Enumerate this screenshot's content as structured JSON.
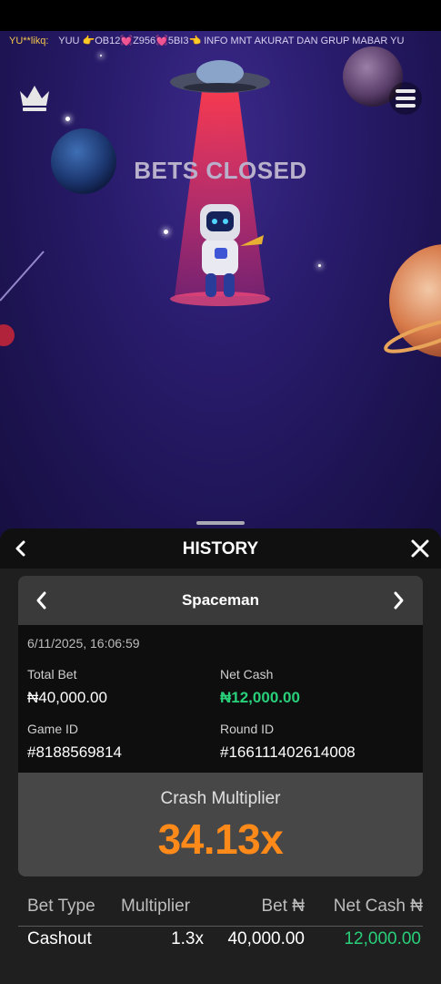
{
  "ticker": {
    "user": "YU**likq:",
    "message": "YUU 👉OB12💓Z956💓5BI3👈 INFO MNT AKURAT DAN GRUP MABAR YU"
  },
  "scene": {
    "status_text": "BETS CLOSED"
  },
  "icons": {
    "crown": "crown-icon",
    "menu": "hamburger-menu-icon",
    "back": "chevron-left-icon",
    "close": "close-icon",
    "prev": "chevron-left-icon",
    "next": "chevron-right-icon"
  },
  "history": {
    "title": "HISTORY",
    "game_name": "Spaceman",
    "timestamp": "6/11/2025, 16:06:59",
    "total_bet_label": "Total Bet",
    "total_bet_value": "₦40,000.00",
    "net_cash_label": "Net Cash",
    "net_cash_value": "₦12,000.00",
    "game_id_label": "Game ID",
    "game_id_value": "#8188569814",
    "round_id_label": "Round ID",
    "round_id_value": "#166111402614008",
    "crash_label": "Crash Multiplier",
    "crash_value": "34.13x",
    "table": {
      "headers": [
        "Bet Type",
        "Multiplier",
        "Bet ₦",
        "Net Cash ₦"
      ],
      "rows": [
        [
          "Cashout",
          "1.3x",
          "40,000.00",
          "12,000.00"
        ]
      ]
    }
  },
  "colors": {
    "accent_orange": "#ff8a1a",
    "positive_green": "#29d07a",
    "panel_bg": "#1f1f1f",
    "scene_purple": "#2a1c6e"
  }
}
